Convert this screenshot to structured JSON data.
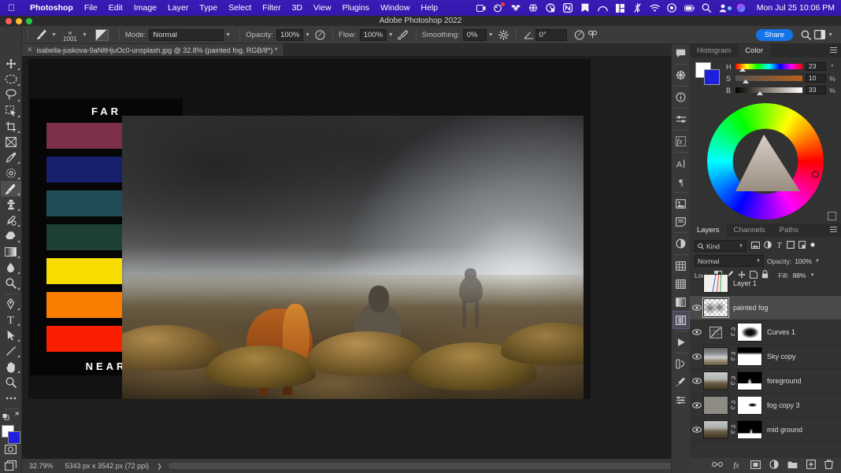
{
  "macmenu": {
    "apple_icon": "apple-icon",
    "items": [
      {
        "label": "Photoshop",
        "bold": true
      },
      {
        "label": "File",
        "bold": false
      },
      {
        "label": "Edit",
        "bold": false
      },
      {
        "label": "Image",
        "bold": false
      },
      {
        "label": "Layer",
        "bold": false
      },
      {
        "label": "Type",
        "bold": false
      },
      {
        "label": "Select",
        "bold": false
      },
      {
        "label": "Filter",
        "bold": false
      },
      {
        "label": "3D",
        "bold": false
      },
      {
        "label": "View",
        "bold": false
      },
      {
        "label": "Plugins",
        "bold": false
      },
      {
        "label": "Window",
        "bold": false
      },
      {
        "label": "Help",
        "bold": false
      }
    ],
    "status_icons": [
      "screen-record-icon",
      "cleanmymac-icon",
      "dropbox-icon",
      "globe-grid-icon",
      "backup-icon",
      "notion-icon",
      "bookmark-icon",
      "rainbow-arc-icon",
      "grid-layout-icon",
      "bluetooth-off-icon",
      "wifi-icon",
      "control-center-icon",
      "battery-icon",
      "search-icon",
      "user-switch-icon",
      "siri-icon"
    ],
    "clock": "Mon Jul 25  10:06 PM"
  },
  "titlebar": {
    "title": "Adobe Photoshop 2022"
  },
  "options": {
    "home_icon": "home-icon",
    "brush_preset_icon": "brush-preset-icon",
    "brush_size": "1001",
    "brush_panel_icon": "brush-settings-panel-icon",
    "mode_label": "Mode:",
    "mode_value": "Normal",
    "opacity_label": "Opacity:",
    "opacity_value": "100%",
    "pressure_opacity_icon": "pressure-opacity-icon",
    "flow_label": "Flow:",
    "flow_value": "100%",
    "airbrush_icon": "airbrush-icon",
    "smoothing_label": "Smoothing:",
    "smoothing_value": "0%",
    "smoothing_options_icon": "gear-icon",
    "angle_icon": "angle-icon",
    "angle_value": "0°",
    "tablet_pressure_icon": "tablet-pressure-size-icon",
    "symmetry_icon": "symmetry-butterfly-icon",
    "share_label": "Share",
    "search_icon": "search-icon",
    "workspace_icon": "workspace-switcher-icon"
  },
  "document_tab": {
    "close_icon": "close-icon",
    "title": "isabella-juskova-9aNltHjuOc0-unsplash.jpg @ 32.8% (painted fog, RGB/8*) *"
  },
  "toolbar": {
    "tools": [
      {
        "name": "move-tool",
        "selected": false,
        "has_flyout": true
      },
      {
        "name": "elliptical-marquee-tool",
        "selected": false,
        "has_flyout": true
      },
      {
        "name": "lasso-tool",
        "selected": false,
        "has_flyout": true
      },
      {
        "name": "object-selection-tool",
        "selected": false,
        "has_flyout": true
      },
      {
        "name": "crop-tool",
        "selected": false,
        "has_flyout": true
      },
      {
        "name": "frame-tool",
        "selected": false,
        "has_flyout": false
      },
      {
        "name": "eyedropper-tool",
        "selected": false,
        "has_flyout": true
      },
      {
        "name": "spot-healing-brush-tool",
        "selected": false,
        "has_flyout": true
      },
      {
        "name": "brush-tool",
        "selected": true,
        "has_flyout": true
      },
      {
        "name": "clone-stamp-tool",
        "selected": false,
        "has_flyout": true
      },
      {
        "name": "history-brush-tool",
        "selected": false,
        "has_flyout": true
      },
      {
        "name": "eraser-tool",
        "selected": false,
        "has_flyout": true
      },
      {
        "name": "gradient-tool",
        "selected": false,
        "has_flyout": true
      },
      {
        "name": "blur-tool",
        "selected": false,
        "has_flyout": true
      },
      {
        "name": "dodge-tool",
        "selected": false,
        "has_flyout": true
      },
      {
        "name": "pen-tool",
        "selected": false,
        "has_flyout": true
      },
      {
        "name": "type-tool",
        "selected": false,
        "has_flyout": true
      },
      {
        "name": "path-selection-tool",
        "selected": false,
        "has_flyout": true
      },
      {
        "name": "line-tool",
        "selected": false,
        "has_flyout": true
      },
      {
        "name": "hand-tool",
        "selected": false,
        "has_flyout": true
      },
      {
        "name": "zoom-tool",
        "selected": false,
        "has_flyout": false
      },
      {
        "name": "edit-toolbar-tool",
        "selected": false,
        "has_flyout": false
      }
    ],
    "default_colors_icon": "default-colors-icon",
    "swap_colors_icon": "swap-colors-icon",
    "foreground_color": "#ffffff",
    "background_color": "#1f1fe0",
    "quick_mask_icon": "quick-mask-icon",
    "screen_mode_icon": "screen-mode-icon"
  },
  "canvas": {
    "depth_chart": {
      "top_label": "FAR",
      "bottom_label": "NEAR",
      "swatches": [
        {
          "name": "swatch-wine",
          "color": "#7d2f4c"
        },
        {
          "name": "swatch-navy",
          "color": "#16206d"
        },
        {
          "name": "swatch-teal",
          "color": "#1f4c57"
        },
        {
          "name": "swatch-forest-green",
          "color": "#1e4033"
        },
        {
          "name": "swatch-yellow",
          "color": "#f7dc00"
        },
        {
          "name": "swatch-orange",
          "color": "#fa7d00"
        },
        {
          "name": "swatch-red",
          "color": "#fa1e00"
        }
      ]
    },
    "photo_alt": "foggy-landscape-with-horses"
  },
  "statusbar": {
    "zoom": "32.79%",
    "dimensions": "5343 px x 3542 px (72 ppi)",
    "expand_icon": "chevron-right-icon"
  },
  "rail": {
    "icons": [
      {
        "name": "comments-panel-icon",
        "active": false
      },
      {
        "name": "3d-panel-icon",
        "active": false
      },
      {
        "name": "info-panel-icon",
        "active": false
      },
      {
        "name": "properties-panel-icon",
        "active": false
      },
      {
        "name": "styles-panel-icon",
        "active": false
      },
      {
        "name": "character-panel-icon",
        "active": false
      },
      {
        "name": "paragraph-panel-icon",
        "active": false
      },
      {
        "name": "libraries-panel-icon",
        "active": false
      },
      {
        "name": "notes-panel-icon",
        "active": false
      },
      {
        "name": "adjustments-panel-icon",
        "active": false
      },
      {
        "name": "swatches-panel-icon",
        "active": false
      },
      {
        "name": "patterns-panel-icon",
        "active": false
      },
      {
        "name": "gradients-panel-icon",
        "active": false
      },
      {
        "name": "layers-panel-icon",
        "active": true
      },
      {
        "name": "timeline-panel-icon",
        "active": false
      },
      {
        "name": "history-panel-icon",
        "active": false
      },
      {
        "name": "brush-settings-panel-icon",
        "active": false
      },
      {
        "name": "tool-presets-panel-icon",
        "active": false
      }
    ]
  },
  "color_panel": {
    "tabs": [
      {
        "label": "Histogram",
        "active": false
      },
      {
        "label": "Color",
        "active": true
      }
    ],
    "menu_icon": "panel-menu-icon",
    "foreground_color": "#ffffff",
    "background_color": "#1f1fe0",
    "sliders": [
      {
        "key": "H",
        "value": "23",
        "unit": "°"
      },
      {
        "key": "S",
        "value": "10",
        "unit": "%"
      },
      {
        "key": "B",
        "value": "33",
        "unit": "%"
      }
    ],
    "wheel_icon": "color-wheel",
    "footer_icon": "color-picker-square-icon"
  },
  "layers_panel": {
    "tabs": [
      {
        "label": "Layers",
        "active": true
      },
      {
        "label": "Channels",
        "active": false
      },
      {
        "label": "Paths",
        "active": false
      }
    ],
    "menu_icon": "panel-menu-icon",
    "filter_icon": "search-icon",
    "filter_label": "Kind",
    "filter_type_icons": [
      "filter-pixel-icon",
      "filter-adjustment-icon",
      "filter-type-icon",
      "filter-shape-icon",
      "filter-smart-object-icon",
      "filter-toggle-icon"
    ],
    "blend_mode": "Normal",
    "opacity_label": "Opacity:",
    "opacity_value": "100%",
    "lock_label": "Lock:",
    "lock_icons": [
      "lock-transparent-pixels-icon",
      "lock-image-pixels-icon",
      "lock-position-icon",
      "lock-artboard-nesting-icon",
      "lock-all-icon"
    ],
    "fill_label": "Fill:",
    "fill_value": "88%",
    "layers": [
      {
        "name": "Layer 1",
        "visible": false,
        "selected": false,
        "has_mask": false,
        "linked": false,
        "thumb": "sketch"
      },
      {
        "name": "painted fog",
        "visible": true,
        "selected": true,
        "has_mask": false,
        "linked": false,
        "thumb": "fog"
      },
      {
        "name": "Curves 1",
        "visible": true,
        "selected": false,
        "has_mask": true,
        "linked": true,
        "thumb": "curves"
      },
      {
        "name": "Sky copy",
        "visible": true,
        "selected": false,
        "has_mask": true,
        "linked": true,
        "thumb": "sky"
      },
      {
        "name": "foreground",
        "visible": true,
        "selected": false,
        "has_mask": true,
        "linked": true,
        "thumb": "land"
      },
      {
        "name": "fog copy 3",
        "visible": true,
        "selected": false,
        "has_mask": true,
        "linked": true,
        "thumb": "gray"
      },
      {
        "name": "mid ground",
        "visible": true,
        "selected": false,
        "has_mask": true,
        "linked": true,
        "thumb": "land"
      }
    ],
    "footer_icons": [
      "link-layers-icon",
      "layer-style-fx-icon",
      "add-layer-mask-icon",
      "new-adjustment-layer-icon",
      "new-group-icon",
      "new-layer-icon",
      "delete-layer-icon"
    ]
  }
}
